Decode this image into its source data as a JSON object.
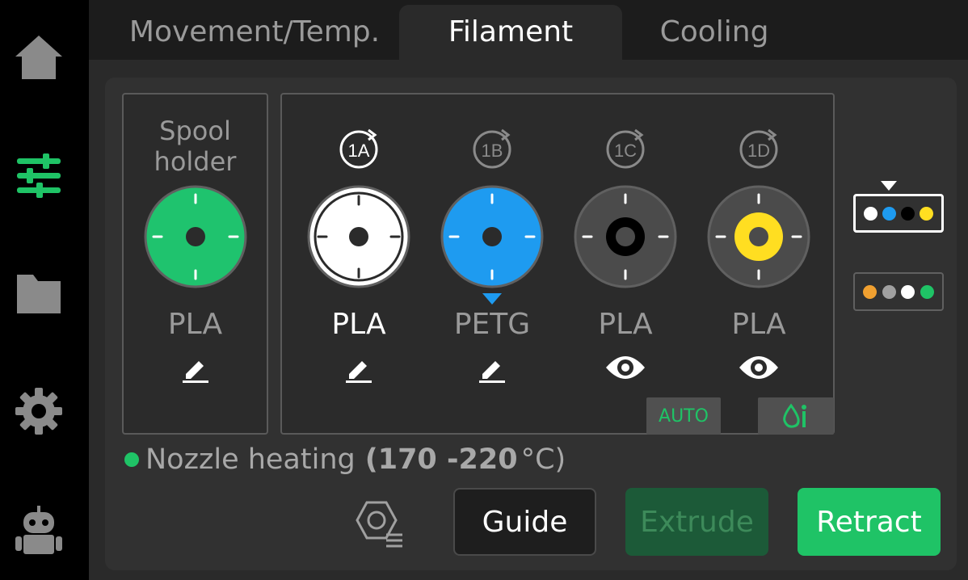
{
  "tabs": [
    {
      "label": "Movement/Temp.",
      "active": false
    },
    {
      "label": "Filament",
      "active": true
    },
    {
      "label": "Cooling",
      "active": false
    }
  ],
  "sidebar": {
    "items": [
      {
        "icon": "home-icon",
        "active": false
      },
      {
        "icon": "sliders-icon",
        "active": true
      },
      {
        "icon": "folder-icon",
        "active": false
      },
      {
        "icon": "gear-icon",
        "active": false
      },
      {
        "icon": "robot-icon",
        "active": false
      }
    ]
  },
  "spool_holder": {
    "title_line1": "Spool",
    "title_line2": "holder",
    "color": "#1fc36e",
    "material": "PLA",
    "action_icon": "edit-icon"
  },
  "ams_slots": [
    {
      "id": "1A",
      "material": "PLA",
      "color": "#ffffff",
      "action_icon": "edit-icon",
      "active": true
    },
    {
      "id": "1B",
      "material": "PETG",
      "color": "#1e9bf0",
      "action_icon": "edit-icon",
      "selected": true
    },
    {
      "id": "1C",
      "material": "PLA",
      "color": "#000000",
      "action_icon": "eye-icon"
    },
    {
      "id": "1D",
      "material": "PLA",
      "color": "#ffde21",
      "action_icon": "eye-icon"
    }
  ],
  "badges": {
    "auto": "AUTO",
    "dry_icon": "humidity-icon"
  },
  "ams_units": [
    {
      "selected": true,
      "colors": [
        "#ffffff",
        "#1e9bf0",
        "#000000",
        "#ffde21"
      ]
    },
    {
      "selected": false,
      "colors": [
        "#f0a030",
        "#a0a0a0",
        "#ffffff",
        "#1fc366"
      ]
    }
  ],
  "status": {
    "text": "Nozzle heating",
    "range": "(170 -220",
    "unit": "°C)",
    "dot_color": "#1fc366"
  },
  "buttons": {
    "nozzle_icon": "nozzle-icon",
    "guide": "Guide",
    "extrude": "Extrude",
    "retract": "Retract"
  },
  "colors": {
    "accent": "#1fc366",
    "accent_dim": "#1c5a38",
    "background": "#000000",
    "panel": "#2a2a2a"
  }
}
